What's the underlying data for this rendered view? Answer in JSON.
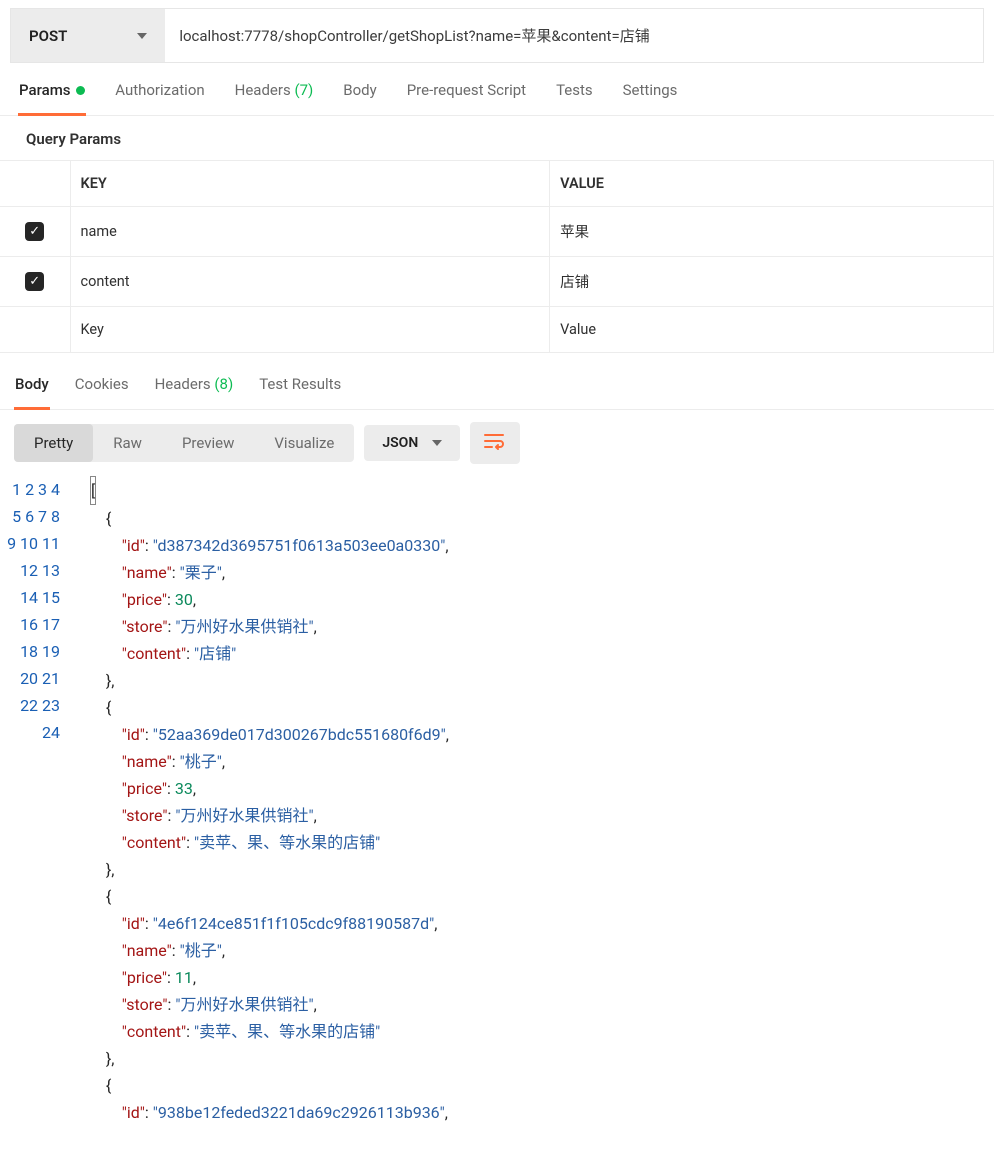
{
  "request": {
    "method": "POST",
    "url": "localhost:7778/shopController/getShopList?name=苹果&content=店铺"
  },
  "tabs": {
    "params": "Params",
    "auth": "Authorization",
    "headers": "Headers",
    "headers_count": "(7)",
    "body": "Body",
    "prereq": "Pre-request Script",
    "tests": "Tests",
    "settings": "Settings"
  },
  "qp_label": "Query Params",
  "table": {
    "h_key": "KEY",
    "h_value": "VALUE",
    "rows": [
      {
        "key": "name",
        "value": "苹果",
        "checked": true
      },
      {
        "key": "content",
        "value": "店铺",
        "checked": true
      }
    ],
    "ph_key": "Key",
    "ph_value": "Value"
  },
  "rtabs": {
    "body": "Body",
    "cookies": "Cookies",
    "headers": "Headers",
    "headers_count": "(8)",
    "test": "Test Results"
  },
  "view": {
    "pretty": "Pretty",
    "raw": "Raw",
    "preview": "Preview",
    "visualize": "Visualize",
    "format": "JSON"
  },
  "response_json": [
    {
      "id": "d387342d3695751f0613a503ee0a0330",
      "name": "栗子",
      "price": 30,
      "store": "万州好水果供销社",
      "content": "店铺"
    },
    {
      "id": "52aa369de017d300267bdc551680f6d9",
      "name": "桃子",
      "price": 33,
      "store": "万州好水果供销社",
      "content": "卖苹、果、等水果的店铺"
    },
    {
      "id": "4e6f124ce851f1f105cdc9f88190587d",
      "name": "桃子",
      "price": 11,
      "store": "万州好水果供销社",
      "content": "卖苹、果、等水果的店铺"
    },
    {
      "id_partial": "938be12feded3221da69c2926113b936"
    }
  ]
}
